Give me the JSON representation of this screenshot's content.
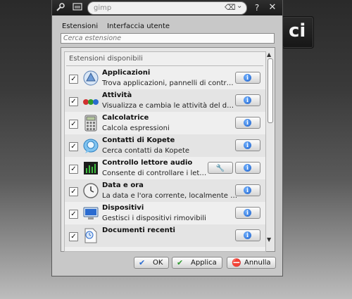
{
  "background": {
    "tile_text": "ci"
  },
  "titlebar": {
    "search_value": "gimp",
    "icons": [
      "wrench-icon",
      "screen-icon",
      "help-icon",
      "close-icon"
    ]
  },
  "tabs": [
    {
      "label": "Estensioni",
      "accesskey": "E"
    },
    {
      "label": "Interfaccia utente",
      "accesskey": "u"
    }
  ],
  "filter": {
    "placeholder": "Cerca estensione"
  },
  "list": {
    "group_title": "Estensioni disponibili",
    "items": [
      {
        "name": "Applicazioni",
        "description": "Trova applicazioni, pannelli di contr…",
        "icon": "applications-icon",
        "checked": true,
        "configurable": false
      },
      {
        "name": "Attività",
        "description": "Visualizza e cambia le attività del d…",
        "icon": "activities-icon",
        "checked": true,
        "configurable": false
      },
      {
        "name": "Calcolatrice",
        "description": "Calcola espressioni",
        "icon": "calculator-icon",
        "checked": true,
        "configurable": false
      },
      {
        "name": "Contatti di Kopete",
        "description": "Cerca contatti da Kopete",
        "icon": "kopete-icon",
        "checked": true,
        "configurable": false
      },
      {
        "name": "Controllo lettore audio",
        "description": "Consente di controllare i let…",
        "icon": "audio-player-icon",
        "checked": true,
        "configurable": true
      },
      {
        "name": "Data e ora",
        "description": "La data e l'ora corrente, localmente …",
        "icon": "clock-icon",
        "checked": true,
        "configurable": false
      },
      {
        "name": "Dispositivi",
        "description": "Gestisci i dispositivi rimovibili",
        "icon": "devices-icon",
        "checked": true,
        "configurable": false
      },
      {
        "name": "Documenti recenti",
        "description": "",
        "icon": "recent-documents-icon",
        "checked": true,
        "configurable": false
      }
    ]
  },
  "buttons": {
    "ok": "OK",
    "apply": "Applica",
    "cancel": "Annulla"
  }
}
